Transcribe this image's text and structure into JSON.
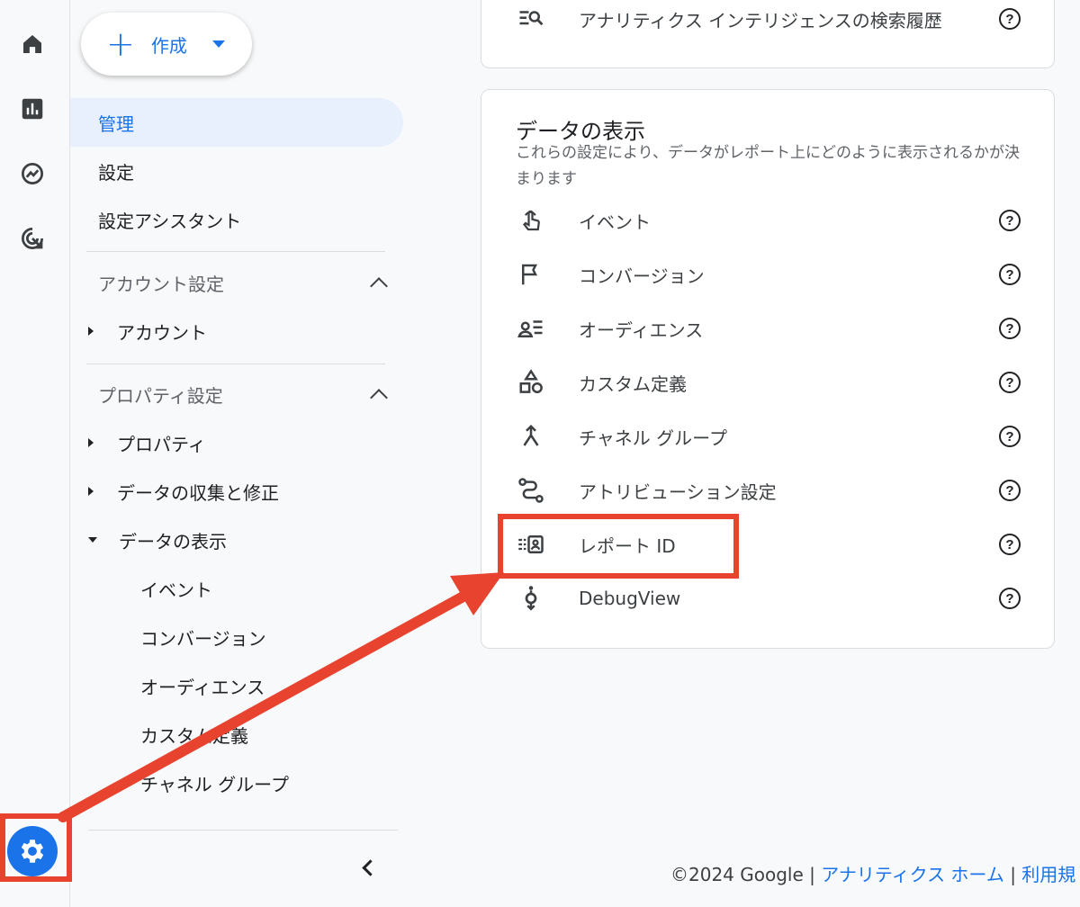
{
  "rail": {
    "icons": [
      "home-icon",
      "reports-icon",
      "explore-icon",
      "advertising-icon"
    ],
    "settings_icon": "gear-icon"
  },
  "create_button": {
    "label": "作成"
  },
  "nav": {
    "admin": "管理",
    "settings": "設定",
    "setup_assistant": "設定アシスタント",
    "account_settings": {
      "header": "アカウント設定",
      "items": [
        "アカウント"
      ]
    },
    "property_settings": {
      "header": "プロパティ設定",
      "items": [
        "プロパティ",
        "データの収集と修正",
        "データの表示"
      ],
      "data_display_children": [
        "イベント",
        "コンバージョン",
        "オーディエンス",
        "カスタム定義",
        "チャネル グループ"
      ]
    }
  },
  "top_card": {
    "row_label": "アナリティクス インテリジェンスの検索履歴"
  },
  "data_display_card": {
    "title": "データの表示",
    "description": "これらの設定により、データがレポート上にどのように表示されるかが決まります",
    "rows": [
      {
        "label": "イベント",
        "icon": "touch-icon"
      },
      {
        "label": "コンバージョン",
        "icon": "flag-icon"
      },
      {
        "label": "オーディエンス",
        "icon": "audience-icon"
      },
      {
        "label": "カスタム定義",
        "icon": "shapes-icon"
      },
      {
        "label": "チャネル グループ",
        "icon": "merge-icon"
      },
      {
        "label": "アトリビューション設定",
        "icon": "route-icon"
      },
      {
        "label": "レポート ID",
        "icon": "report-id-icon"
      },
      {
        "label": "DebugView",
        "icon": "debug-icon"
      }
    ],
    "help_glyph": "?"
  },
  "footer": {
    "copyright": "©2024 Google",
    "separator": "|",
    "home_link": "アナリティクス ホーム",
    "terms_link": "利用規"
  },
  "annotation_color": "#e8432e"
}
